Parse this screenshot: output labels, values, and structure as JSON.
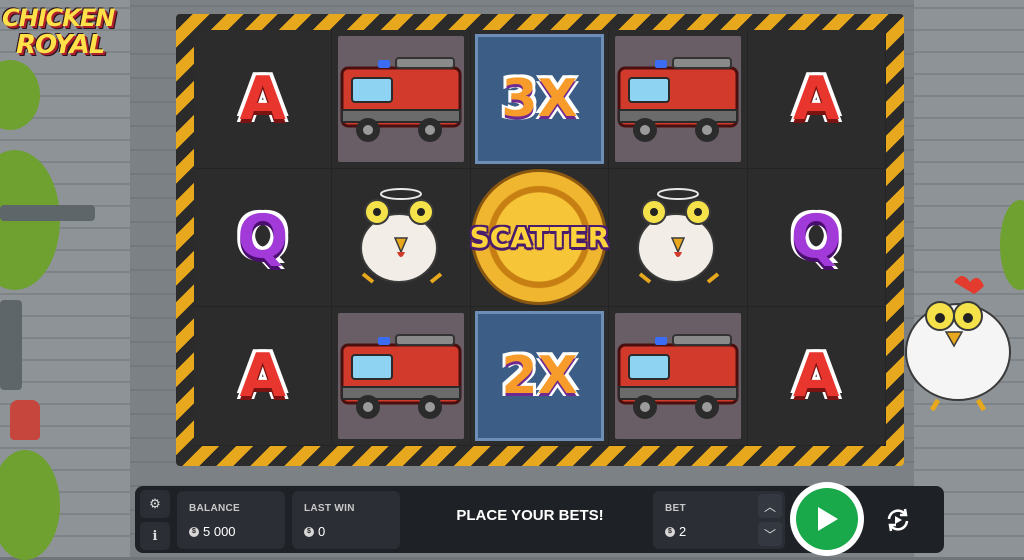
{
  "game": {
    "logo_line1": "CHICKEN",
    "logo_line2": "ROYAL"
  },
  "reels": [
    [
      {
        "symbol": "A",
        "kind": "letter",
        "color": "red"
      },
      {
        "symbol": "fire-truck",
        "kind": "truck"
      },
      {
        "symbol": "3X",
        "kind": "multiplier"
      },
      {
        "symbol": "fire-truck",
        "kind": "truck"
      },
      {
        "symbol": "A",
        "kind": "letter",
        "color": "red"
      }
    ],
    [
      {
        "symbol": "Q",
        "kind": "letter",
        "color": "purple"
      },
      {
        "symbol": "dead-chicken",
        "kind": "chicken"
      },
      {
        "symbol": "SCATTER",
        "kind": "scatter"
      },
      {
        "symbol": "dead-chicken",
        "kind": "chicken"
      },
      {
        "symbol": "Q",
        "kind": "letter",
        "color": "purple"
      }
    ],
    [
      {
        "symbol": "A",
        "kind": "letter",
        "color": "red"
      },
      {
        "symbol": "fire-truck",
        "kind": "truck"
      },
      {
        "symbol": "2X",
        "kind": "multiplier"
      },
      {
        "symbol": "fire-truck",
        "kind": "truck"
      },
      {
        "symbol": "A",
        "kind": "letter",
        "color": "red"
      }
    ]
  ],
  "controls": {
    "balance_label": "BALANCE",
    "balance_value": "5 000",
    "last_win_label": "LAST WIN",
    "last_win_value": "0",
    "message": "PLACE YOUR BETS!",
    "bet_label": "BET",
    "bet_value": "2",
    "coin_symbol": "$"
  },
  "colors": {
    "spin_button": "#19a84a",
    "accent_stripe": "#e8a81d",
    "letter_red": "#e8362f",
    "letter_purple": "#a13ad8"
  }
}
